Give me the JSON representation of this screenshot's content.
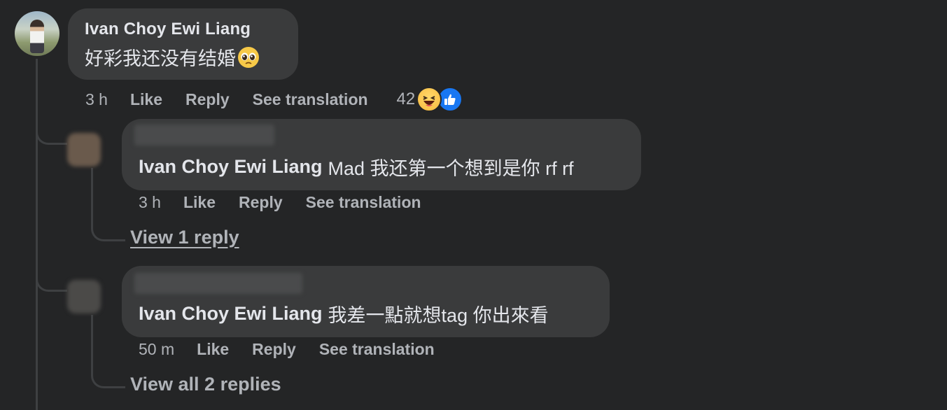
{
  "main_comment": {
    "author": "Ivan Choy Ewi Liang",
    "text": "好彩我还没有结婚",
    "emoji": "pleading-face",
    "time": "3 h",
    "like_label": "Like",
    "reply_label": "Reply",
    "translate_label": "See translation",
    "reaction_count": "42",
    "reaction_icons": [
      "haha-icon",
      "like-icon"
    ]
  },
  "replies": [
    {
      "tag": "Ivan Choy Ewi Liang",
      "text": "Mad 我还第一个想到是你 rf rf",
      "time": "3 h",
      "like_label": "Like",
      "reply_label": "Reply",
      "translate_label": "See translation",
      "view_more": "View 1 reply"
    },
    {
      "tag": "Ivan Choy Ewi Liang",
      "text": "我差一點就想tag 你出來看",
      "time": "50 m",
      "like_label": "Like",
      "reply_label": "Reply",
      "translate_label": "See translation",
      "view_more": "View all 2 replies"
    }
  ],
  "colors": {
    "background": "#242526",
    "bubble": "#3a3b3c",
    "primary_text": "#e4e6eb",
    "secondary_text": "#b0b3b8",
    "like_blue": "#1877f2",
    "haha_yellow": "#f9b93c"
  }
}
